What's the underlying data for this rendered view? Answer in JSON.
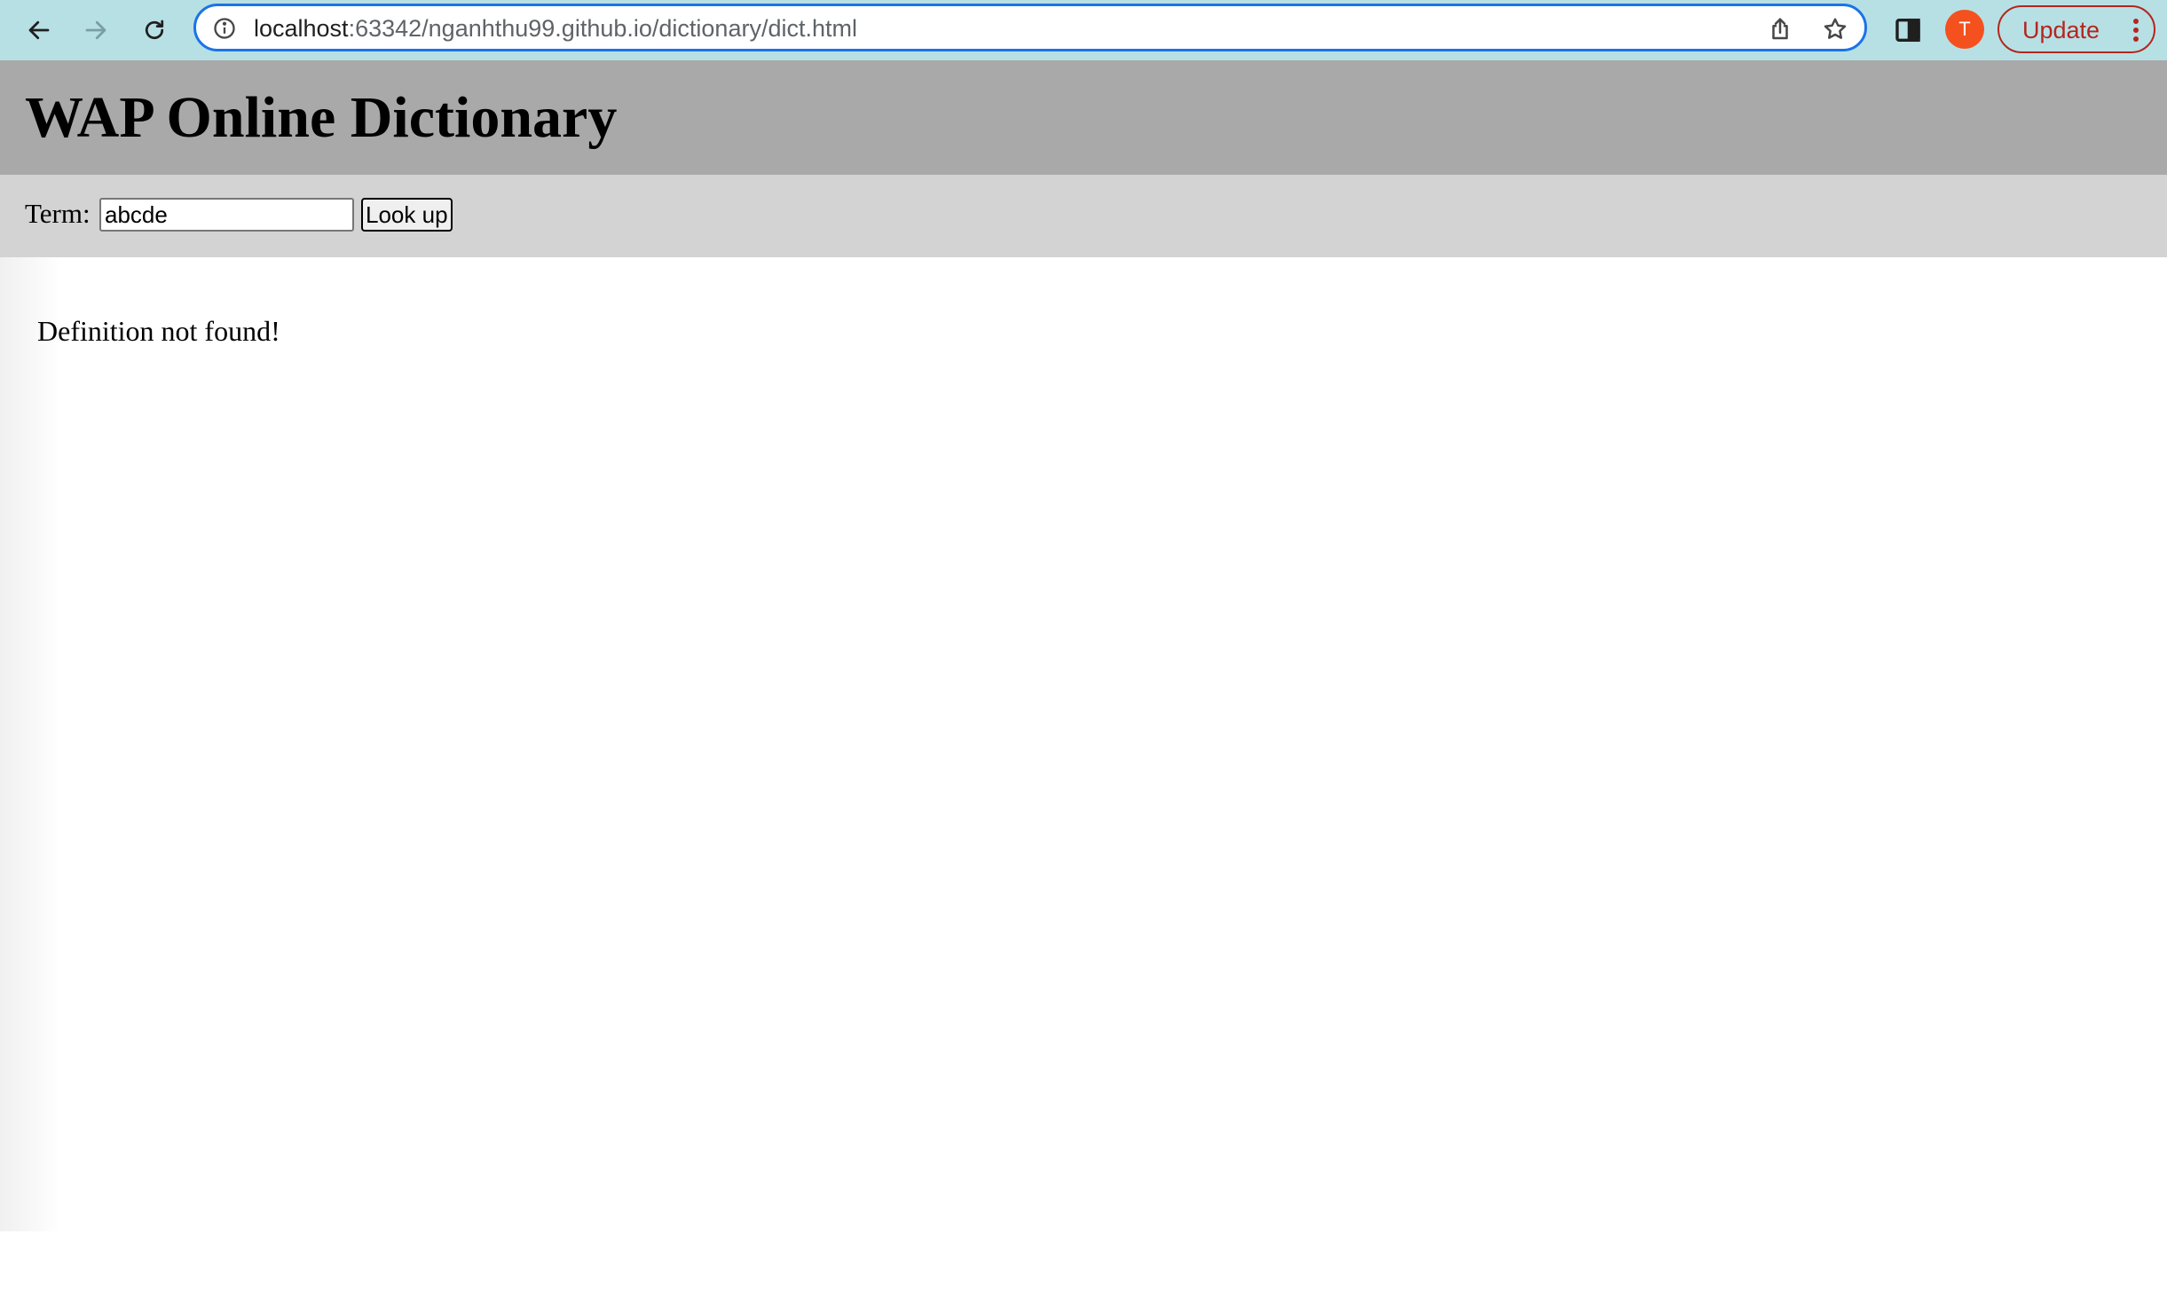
{
  "browser": {
    "url_host": "localhost",
    "url_path": ":63342/nganhthu99.github.io/dictionary/dict.html",
    "profile_initial": "T",
    "update_label": "Update",
    "icons": {
      "back": "back-arrow-icon",
      "forward": "forward-arrow-icon",
      "reload": "reload-icon",
      "site_info": "site-info-icon",
      "share": "share-icon",
      "bookmark": "bookmark-star-icon",
      "side_panel": "side-panel-icon",
      "menu": "more-vertical-icon"
    },
    "colors": {
      "toolbar": "#b7e0e5",
      "omnibox_border": "#1a73e8",
      "avatar": "#f4511e",
      "update": "#b3261e"
    }
  },
  "page": {
    "title": "WAP Online Dictionary",
    "term_label": "Term:",
    "term_value": "abcde",
    "lookup_label": "Look up",
    "result_text": "Definition not found!",
    "colors": {
      "header_bg": "#a9a9a9",
      "searchbar_bg": "#d3d3d3"
    }
  }
}
